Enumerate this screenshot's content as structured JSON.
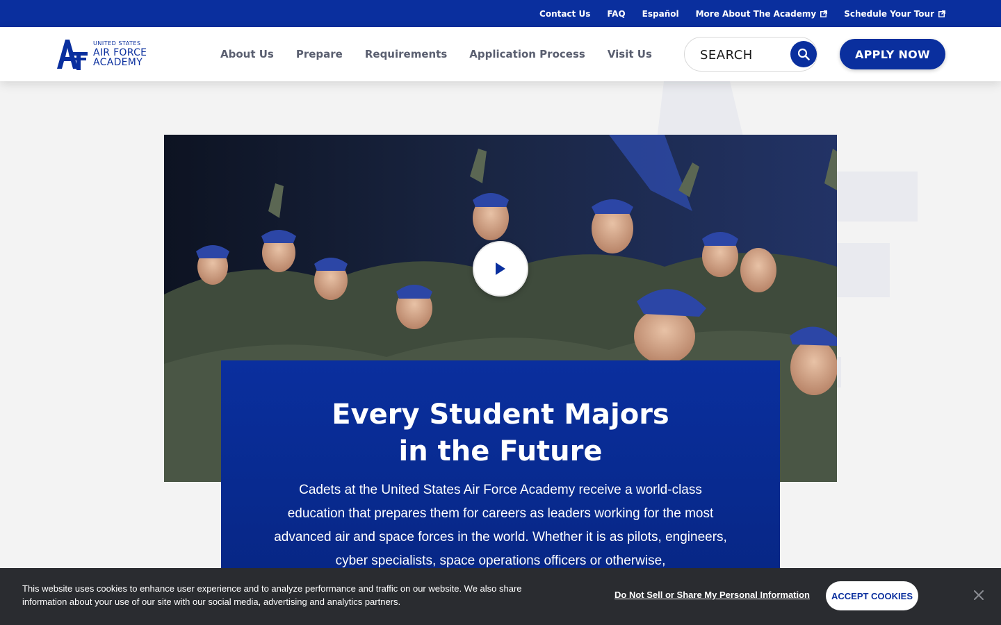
{
  "utility_nav": {
    "links": [
      {
        "label": "Contact Us",
        "external": false
      },
      {
        "label": "FAQ",
        "external": false
      },
      {
        "label": "Español",
        "external": false
      },
      {
        "label": "More About The Academy",
        "external": true
      },
      {
        "label": "Schedule Your Tour",
        "external": true
      }
    ]
  },
  "header": {
    "logo": {
      "line1": "UNITED STATES",
      "line2": "AIR FORCE",
      "line3": "ACADEMY"
    },
    "nav": [
      "About Us",
      "Prepare",
      "Requirements",
      "Application Process",
      "Visit Us"
    ],
    "search_placeholder": "SEARCH",
    "apply_label": "APPLY NOW"
  },
  "hero": {
    "title": "Every Student Majors in the Future",
    "body": "Cadets at the United States Air Force Academy receive a world-class education that prepares them for careers as leaders working for the most advanced air and space forces in the world. Whether it is as pilots, engineers, cyber specialists, space operations officers or otherwise,",
    "media_alt": "play-icon"
  },
  "cookie_banner": {
    "text": "This website uses cookies to enhance user experience and to analyze performance and traffic on our website. We also share information about your use of our site with our social media, advertising and analytics partners.",
    "do_not_sell_label": "Do Not Sell or Share My Personal Information",
    "accept_label": "ACCEPT COOKIES"
  },
  "colors": {
    "brand_blue": "#0a2f9e",
    "banner_dark": "#2a2c30",
    "background": "#f3f3f3"
  }
}
